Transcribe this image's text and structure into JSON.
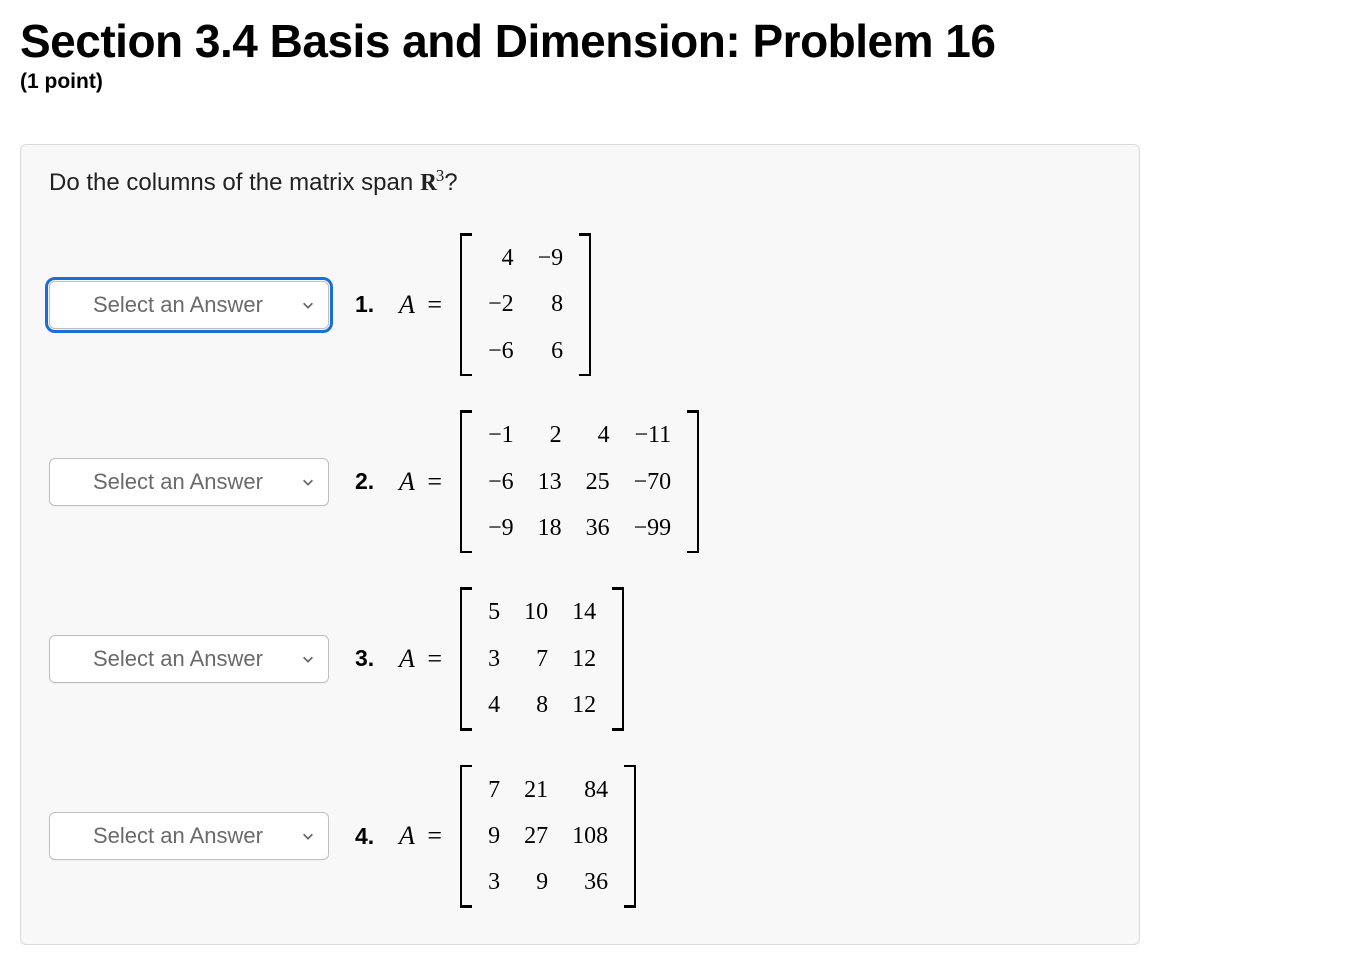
{
  "header": {
    "title": "Section 3.4 Basis and Dimension: Problem 16",
    "points": "(1 point)"
  },
  "question": {
    "prefix": "Do the columns of the matrix span ",
    "set": "R",
    "exponent": "3",
    "suffix": "?"
  },
  "select_placeholder": "Select an Answer",
  "A_equals": "A =",
  "items": [
    {
      "number": "1.",
      "focused": true,
      "matrix": [
        [
          "4",
          "−9"
        ],
        [
          "−2",
          "8"
        ],
        [
          "−6",
          "6"
        ]
      ]
    },
    {
      "number": "2.",
      "focused": false,
      "matrix": [
        [
          "−1",
          "2",
          "4",
          "−11"
        ],
        [
          "−6",
          "13",
          "25",
          "−70"
        ],
        [
          "−9",
          "18",
          "36",
          "−99"
        ]
      ]
    },
    {
      "number": "3.",
      "focused": false,
      "matrix": [
        [
          "5",
          "10",
          "14"
        ],
        [
          "3",
          "7",
          "12"
        ],
        [
          "4",
          "8",
          "12"
        ]
      ]
    },
    {
      "number": "4.",
      "focused": false,
      "matrix": [
        [
          "7",
          "21",
          "84"
        ],
        [
          "9",
          "27",
          "108"
        ],
        [
          "3",
          "9",
          "36"
        ]
      ]
    }
  ]
}
